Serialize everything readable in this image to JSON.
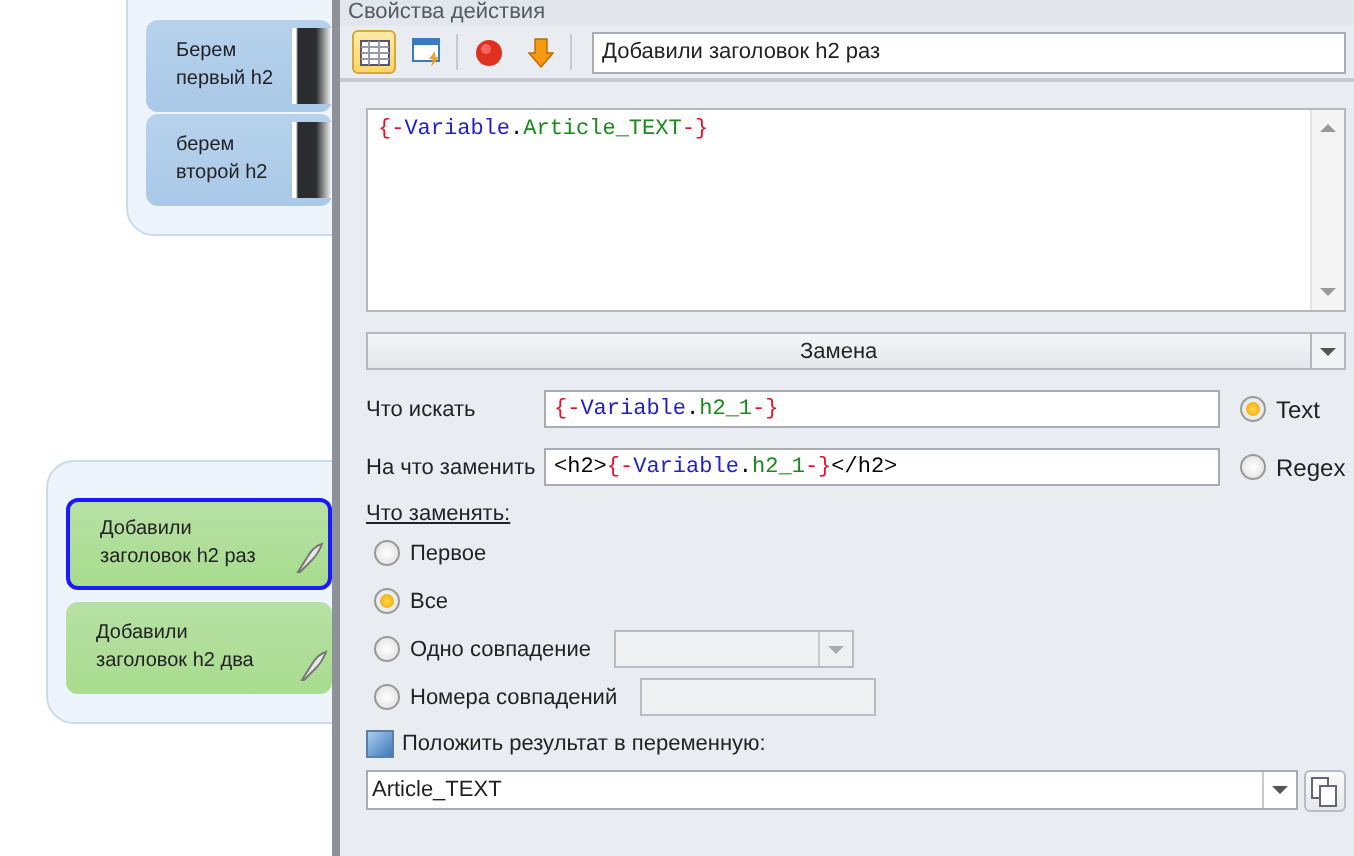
{
  "canvas": {
    "groups": [
      {
        "color": "#a9c9e8",
        "nodes": [
          {
            "label": "Берем\nпервый h2",
            "kind": "image",
            "selected": false
          },
          {
            "label": "берем\nвторой h2",
            "kind": "image",
            "selected": false
          }
        ]
      },
      {
        "color": "#a8dc8e",
        "nodes": [
          {
            "label": "Добавили\nзаголовок h2 раз",
            "kind": "pen",
            "selected": true
          },
          {
            "label": "Добавили\nзаголовок h2 два",
            "kind": "pen",
            "selected": false
          }
        ]
      }
    ]
  },
  "panel": {
    "title": "Свойства действия",
    "toolbar": [
      {
        "kind": "table",
        "selected": true
      },
      {
        "kind": "window",
        "selected": false
      },
      {
        "kind": "record",
        "selected": false
      },
      {
        "kind": "down",
        "selected": false
      }
    ],
    "action_name": "Добавили заголовок h2 раз",
    "code": [
      {
        "kind": "brace",
        "text": "{-"
      },
      {
        "kind": "var",
        "text": "Variable"
      },
      {
        "kind": "plain",
        "text": "."
      },
      {
        "kind": "name",
        "text": "Article_TEXT"
      },
      {
        "kind": "brace",
        "text": "-}"
      }
    ],
    "operation": "Замена",
    "find": {
      "label": "Что искать",
      "tokens": [
        {
          "kind": "brace",
          "text": "{-"
        },
        {
          "kind": "var",
          "text": "Variable"
        },
        {
          "kind": "plain",
          "text": "."
        },
        {
          "kind": "name",
          "text": "h2_1"
        },
        {
          "kind": "brace",
          "text": "-}"
        }
      ]
    },
    "replace": {
      "label": "На что заменить",
      "tokens": [
        {
          "kind": "plain",
          "text": "<h2>"
        },
        {
          "kind": "brace",
          "text": "{-"
        },
        {
          "kind": "var",
          "text": "Variable"
        },
        {
          "kind": "plain",
          "text": "."
        },
        {
          "kind": "name",
          "text": "h2_1"
        },
        {
          "kind": "brace",
          "text": "-}"
        },
        {
          "kind": "plain",
          "text": "</h2>"
        }
      ]
    },
    "mode": [
      {
        "label": "Text",
        "selected": true
      },
      {
        "label": "Regex",
        "selected": false
      }
    ],
    "scope_label": "Что заменять:",
    "scope": [
      {
        "label": "Первое",
        "kind": "plain",
        "selected": false
      },
      {
        "label": "Все",
        "kind": "plain",
        "selected": true
      },
      {
        "label": "Одно совпадение",
        "kind": "combo",
        "selected": false
      },
      {
        "label": "Номера совпадений",
        "kind": "field",
        "selected": false
      }
    ],
    "result": {
      "label": "Положить результат в переменную:",
      "checked": false,
      "value": "Article_TEXT"
    }
  }
}
